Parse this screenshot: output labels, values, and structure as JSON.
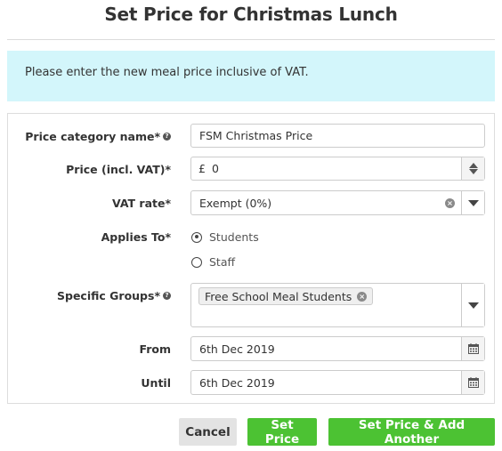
{
  "page": {
    "title": "Set Price for Christmas Lunch",
    "info_text": "Please enter the new meal price inclusive of VAT."
  },
  "form": {
    "price_category": {
      "label": "Price category name*",
      "help_icon": "question-circle-icon",
      "value": "FSM Christmas Price"
    },
    "price": {
      "label": "Price (incl. VAT)*",
      "currency_symbol": "£",
      "value": "0"
    },
    "vat_rate": {
      "label": "VAT rate*",
      "value": "Exempt (0%)"
    },
    "applies_to": {
      "label": "Applies To*",
      "options": [
        {
          "label": "Students",
          "selected": true
        },
        {
          "label": "Staff",
          "selected": false
        }
      ]
    },
    "specific_groups": {
      "label": "Specific Groups*",
      "help_icon": "question-circle-icon",
      "tags": [
        "Free School Meal Students"
      ]
    },
    "from": {
      "label": "From",
      "value": "6th Dec 2019",
      "icon": "calendar-icon"
    },
    "until": {
      "label": "Until",
      "value": "6th Dec 2019",
      "icon": "calendar-icon"
    }
  },
  "actions": {
    "cancel_label": "Cancel",
    "set_price_label": "Set Price",
    "set_price_add_label": "Set Price & Add Another"
  },
  "colors": {
    "info_background": "#d3f6fb",
    "primary_button": "#4cc233",
    "secondary_button": "#e3e3e3"
  }
}
